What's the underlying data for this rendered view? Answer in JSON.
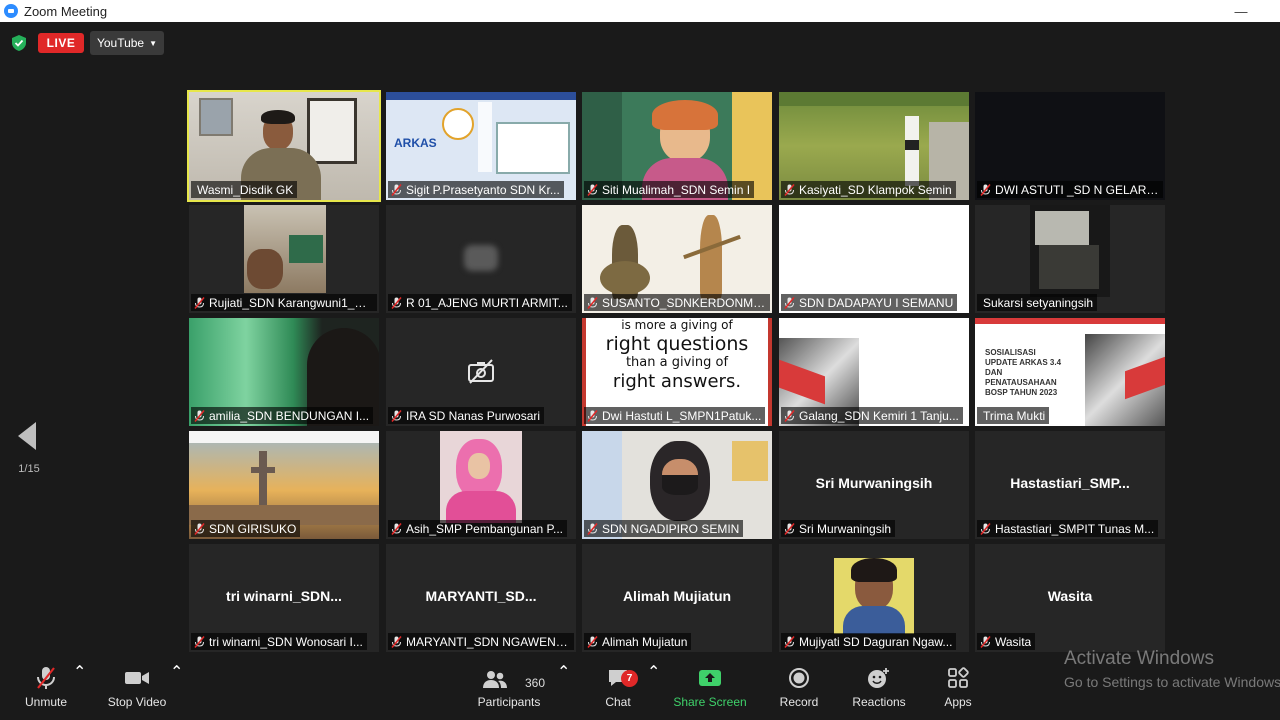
{
  "window": {
    "title": "Zoom Meeting"
  },
  "topbar": {
    "live_label": "LIVE",
    "stream_label": "YouTube"
  },
  "gallery": {
    "page_indicator": "1/15",
    "tiles": [
      {
        "name": "Wasmi_Disdik GK",
        "active": true,
        "muted": false,
        "kind": "person-office"
      },
      {
        "name": "Sigit P.Prasetyanto SDN Kr...",
        "muted": true,
        "kind": "slide-arkas"
      },
      {
        "name": "Siti Mualimah_SDN Semin I",
        "muted": true,
        "kind": "person-classroom"
      },
      {
        "name": "Kasiyati_SD Klampok Semin",
        "muted": true,
        "kind": "outdoor-field"
      },
      {
        "name": "DWI ASTUTI _SD N GELARA...",
        "muted": true,
        "kind": "dark"
      },
      {
        "name": "Rujiati_SDN Karangwuni1_R...",
        "muted": true,
        "kind": "small-room"
      },
      {
        "name": "R 01_AJENG MURTI ARMIT...",
        "muted": true,
        "kind": "blurred"
      },
      {
        "name": "SUSANTO_SDNKERDONMI...",
        "muted": true,
        "kind": "wayang"
      },
      {
        "name": "SDN DADAPAYU I SEMANU",
        "muted": true,
        "kind": "white"
      },
      {
        "name": "Sukarsi setyaningsih",
        "muted": false,
        "kind": "dark-room"
      },
      {
        "name": "amilia_SDN BENDUNGAN I...",
        "muted": true,
        "kind": "green-curtain"
      },
      {
        "name": "IRA SD Nanas Purwosari",
        "muted": true,
        "kind": "video-off"
      },
      {
        "name": "Dwi Hastuti L_SMPN1Patuk...",
        "muted": true,
        "kind": "quote",
        "quote_lines": [
          "is more a giving of",
          "right questions",
          "than a giving of",
          "right answers."
        ]
      },
      {
        "name": "Galang_SDN Kemiri 1 Tanju...",
        "muted": true,
        "kind": "slide-mirror"
      },
      {
        "name": "Trima Mukti",
        "muted": false,
        "kind": "slide-sosialisasi",
        "slide_lines": [
          "SOSIALISASI",
          "UPDATE ARKAS 3.4",
          "DAN",
          "PENATAUSAHAAN",
          "BOSP TAHUN 2023"
        ]
      },
      {
        "name": "SDN GIRISUKO",
        "muted": true,
        "kind": "photo-landmark"
      },
      {
        "name": "Asih_SMP Pembangunan P...",
        "muted": true,
        "kind": "person-pink"
      },
      {
        "name": "SDN NGADIPIRO SEMIN",
        "muted": true,
        "kind": "person-mask"
      },
      {
        "name": "Sri Murwaningsih",
        "muted": true,
        "kind": "text",
        "display": "Sri Murwaningsih"
      },
      {
        "name": "Hastastiari_SMPIT Tunas M...",
        "muted": true,
        "kind": "text",
        "display": "Hastastiari_SMP..."
      },
      {
        "name": "tri winarni_SDN Wonosari I...",
        "muted": true,
        "kind": "text",
        "display": "tri  winarni_SDN..."
      },
      {
        "name": "MARYANTI_SDN NGAWEN IV",
        "muted": true,
        "kind": "text",
        "display": "MARYANTI_SD..."
      },
      {
        "name": "Alimah Mujiatun",
        "muted": true,
        "kind": "text",
        "display": "Alimah Mujiatun"
      },
      {
        "name": "Mujiyati SD Daguran Ngaw...",
        "muted": true,
        "kind": "person-photo"
      },
      {
        "name": "Wasita",
        "muted": true,
        "kind": "text",
        "display": "Wasita"
      }
    ]
  },
  "toolbar": {
    "unmute": "Unmute",
    "stop_video": "Stop Video",
    "participants": "Participants",
    "participants_count": "360",
    "chat": "Chat",
    "chat_badge": "7",
    "share_screen": "Share Screen",
    "record": "Record",
    "reactions": "Reactions",
    "apps": "Apps"
  },
  "watermark": {
    "line1": "Activate Windows",
    "line2": "Go to Settings to activate Windows."
  },
  "colors": {
    "live": "#e02828",
    "active_speaker": "#e7e74b",
    "share_green": "#3fd16a",
    "accent": "#2d8cff"
  }
}
